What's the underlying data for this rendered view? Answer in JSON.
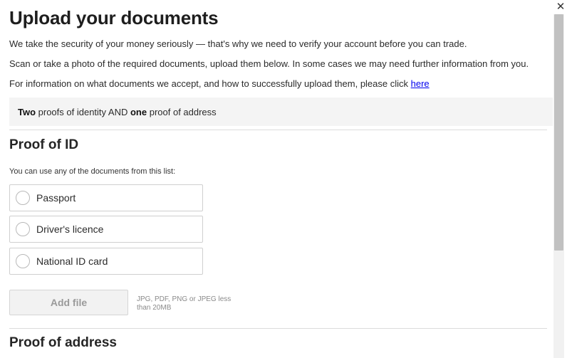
{
  "modal": {
    "title": "Upload your documents",
    "close_icon": "close-icon",
    "intro": {
      "line1": "We take the security of your money seriously — that's why we need to verify your account before you can trade.",
      "line2": "Scan or take a photo of the required documents, upload them below. In some cases we may need further information from you.",
      "line3_prefix": "For information on what documents we accept, and how to successfully upload them, please click ",
      "line3_link": "here"
    },
    "requirements": {
      "count_id": "Two",
      "text_id": " proofs of identity AND ",
      "count_address": "one",
      "text_address": " proof of address"
    },
    "proof_of_id": {
      "title": "Proof of ID",
      "helper": "You can use any of the documents from this list:",
      "options": [
        {
          "label": "Passport",
          "selected": false
        },
        {
          "label": "Driver's licence",
          "selected": false
        },
        {
          "label": "National ID card",
          "selected": false
        }
      ],
      "add_file_label": "Add file",
      "file_hint": "JPG, PDF, PNG or JPEG less than 20MB"
    },
    "proof_of_address": {
      "title": "Proof of address"
    }
  },
  "colors": {
    "link": "#0000ee",
    "requirements_bg": "#f4f4f4",
    "disabled_text": "#9a9a9a"
  }
}
